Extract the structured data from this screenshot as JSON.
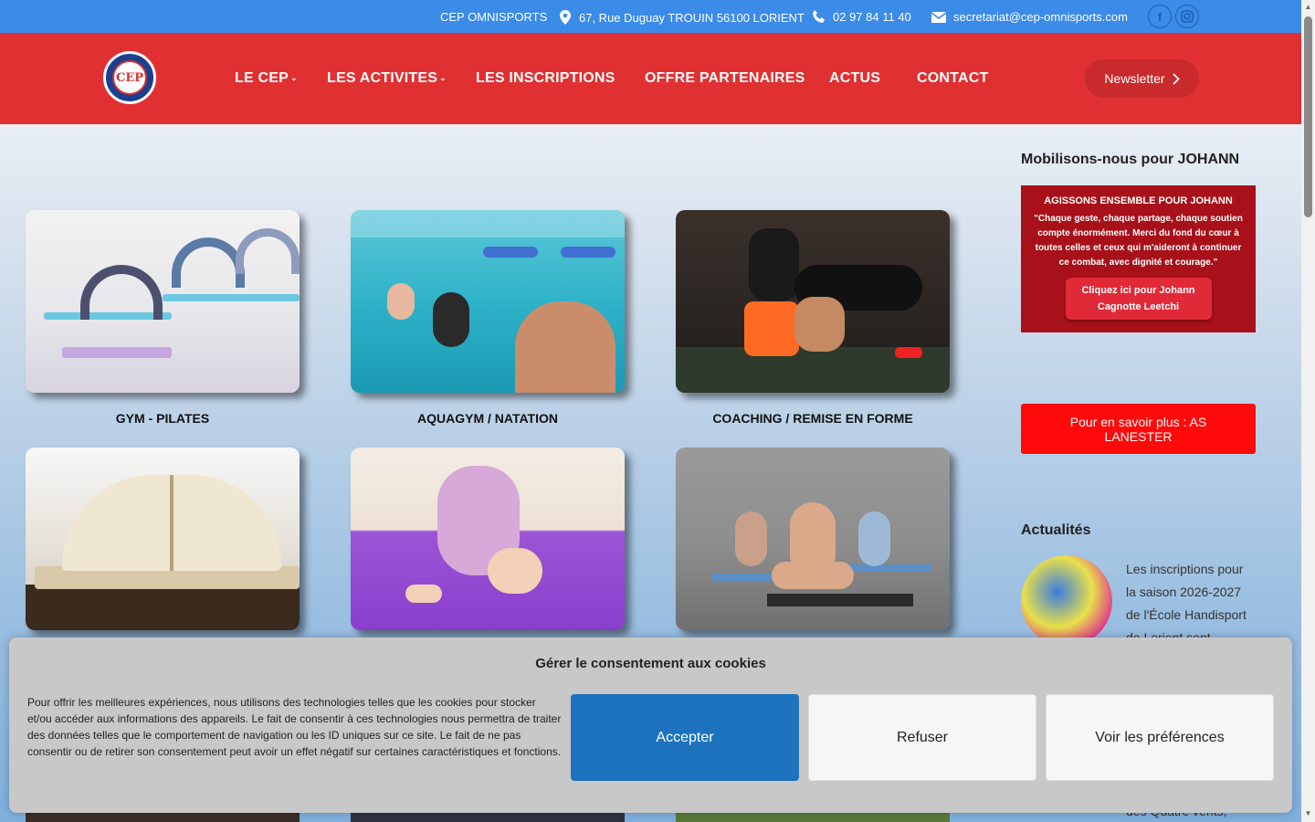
{
  "topbar": {
    "org": "CEP OMNISPORTS",
    "address": "67, Rue Duguay TROUIN 56100 LORIENT",
    "phone": "02 97 84 11 40",
    "email": "secretariat@cep-omnisports.com"
  },
  "header": {
    "logo_text": "CEP",
    "nav": [
      {
        "label": "LE CEP"
      },
      {
        "label": "LES ACTIVITES"
      },
      {
        "label": "LES INSCRIPTIONS"
      },
      {
        "label": "OFFRE PARTENAIRES"
      },
      {
        "label": "ACTUS"
      },
      {
        "label": "CONTACT"
      }
    ],
    "newsletter": "Newsletter"
  },
  "activities": [
    {
      "title": "GYM - PILATES"
    },
    {
      "title": "AQUAGYM / NATATION"
    },
    {
      "title": "COACHING / REMISE EN FORME"
    }
  ],
  "sidebar": {
    "johann_title": "Mobilisons-nous pour JOHANN",
    "johann_banner_heading": "AGISSONS ENSEMBLE POUR JOHANN",
    "johann_banner_quote": "\"Chaque geste, chaque partage, chaque soutien compte énormément. Merci du fond du cœur à toutes celles et ceux qui m'aideront à continuer ce combat, avec dignité et courage.\"",
    "johann_banner_button_line1": "Cliquez ici pour Johann",
    "johann_banner_button_line2": "Cagnotte Leetchi",
    "lanester_button": "Pour en savoir plus : AS LANESTER",
    "news_title": "Actualités",
    "news_text": "Les inscriptions pour la saison 2026-2027 de l'École Handisport de Lorient sont",
    "news_text_bottom": "des Quatre vents,"
  },
  "cookie": {
    "title": "Gérer le consentement aux cookies",
    "text": "Pour offrir les meilleures expériences, nous utilisons des technologies telles que les cookies pour stocker et/ou accéder aux informations des appareils. Le fait de consentir à ces technologies nous permettra de traiter des données telles que le comportement de navigation ou les ID uniques sur ce site. Le fait de ne pas consentir ou de retirer son consentement peut avoir un effet négatif sur certaines caractéristiques et fonctions.",
    "accept": "Accepter",
    "refuse": "Refuser",
    "preferences": "Voir les préférences"
  },
  "colors": {
    "topbar": "#3b8be8",
    "header": "#e03032",
    "accept": "#1e73be",
    "lanester": "#ff0a0a"
  }
}
